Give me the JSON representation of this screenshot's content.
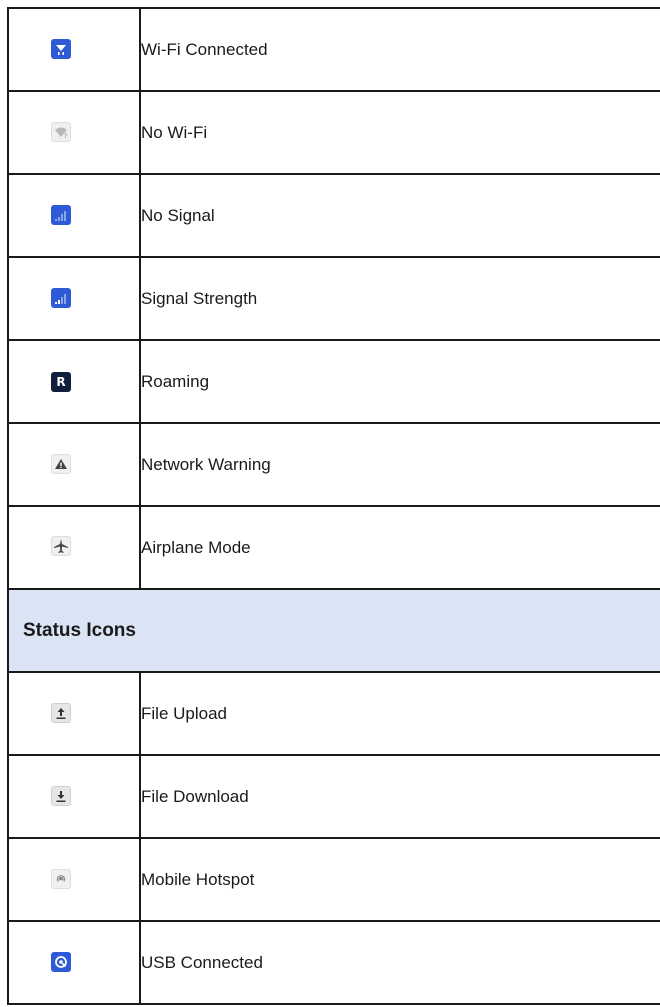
{
  "rows_network": [
    {
      "icon": "wifi-connected-icon",
      "label": "Wi-Fi Connected"
    },
    {
      "icon": "no-wifi-icon",
      "label": "No Wi-Fi"
    },
    {
      "icon": "no-signal-icon",
      "label": "No Signal"
    },
    {
      "icon": "signal-strength-icon",
      "label": "Signal Strength"
    },
    {
      "icon": "roaming-icon",
      "label": "Roaming",
      "glyph": "R"
    },
    {
      "icon": "network-warning-icon",
      "label": "Network Warning"
    },
    {
      "icon": "airplane-mode-icon",
      "label": "Airplane Mode"
    }
  ],
  "section": {
    "title": "Status Icons"
  },
  "rows_status": [
    {
      "icon": "file-upload-icon",
      "label": "File Upload"
    },
    {
      "icon": "file-download-icon",
      "label": "File Download"
    },
    {
      "icon": "mobile-hotspot-icon",
      "label": "Mobile Hotspot"
    },
    {
      "icon": "usb-connected-icon",
      "label": "USB Connected"
    }
  ],
  "colors": {
    "section_background": "#dbe4f5",
    "icon_blue": "#2d5bd6",
    "icon_dark": "#0f1e3c",
    "border": "#1a1a1a"
  }
}
